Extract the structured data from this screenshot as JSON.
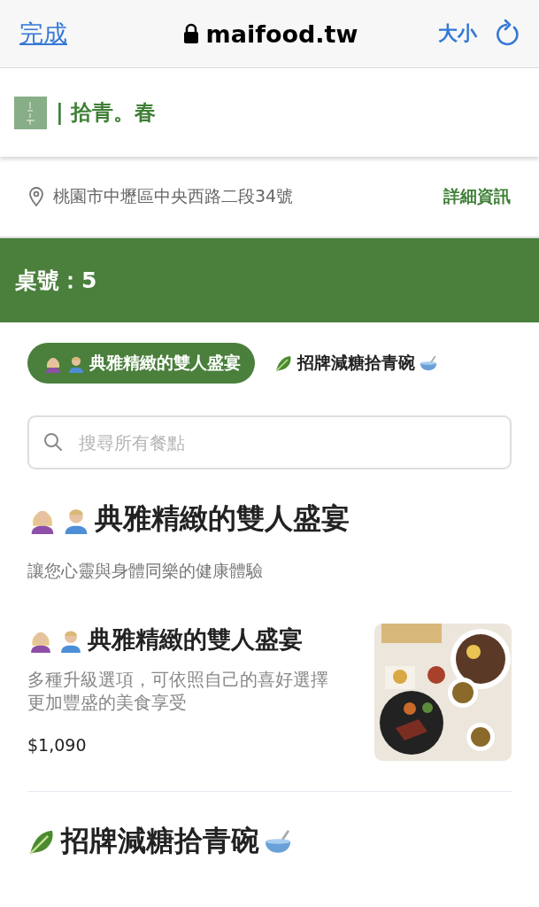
{
  "browser_bar": {
    "done": "完成",
    "url": "maifood.tw",
    "text_size": "大小"
  },
  "shop": {
    "name": "| 拾青。春",
    "address": "桃園市中壢區中央西路二段34號",
    "details_link": "詳細資訊"
  },
  "table_bar": {
    "label": "桌號：5"
  },
  "tabs": [
    {
      "label": "典雅精緻的雙人盛宴",
      "kind": "couple",
      "selected": true
    },
    {
      "label": "招牌減糖拾青碗",
      "kind": "bowl",
      "selected": false
    }
  ],
  "search": {
    "placeholder": "搜尋所有餐點"
  },
  "sections": [
    {
      "title": "典雅精緻的雙人盛宴",
      "kind": "couple",
      "subtitle": "讓您心靈與身體同樂的健康體驗",
      "items": [
        {
          "name": "典雅精緻的雙人盛宴",
          "kind": "couple",
          "description": "多種升級選項，可依照自己的喜好選擇更加豐盛的美食享受",
          "price": "$1,090"
        }
      ]
    },
    {
      "title": "招牌減糖拾青碗",
      "kind": "bowl"
    }
  ]
}
